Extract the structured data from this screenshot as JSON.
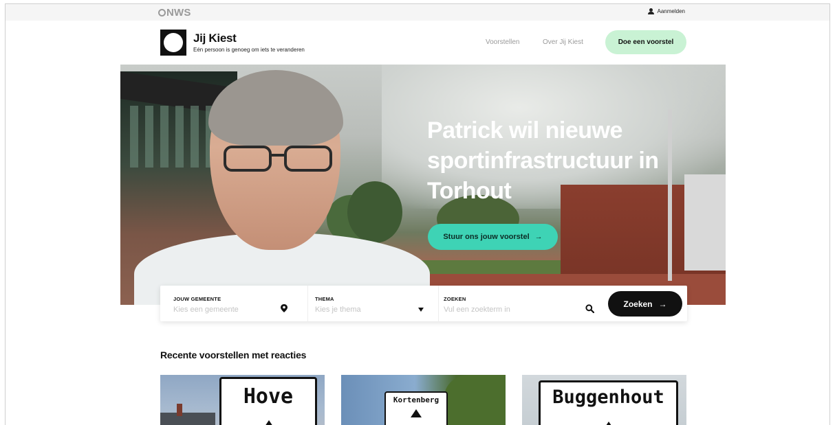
{
  "topbar": {
    "logo_text": "NWS",
    "login_label": "Aanmelden",
    "icons": {
      "user": "user-icon"
    }
  },
  "header": {
    "brand_title": "Jij Kiest",
    "brand_subtitle": "Eén persoon is genoeg om iets te veranderen",
    "nav": [
      "Voorstellen",
      "Over Jij Kiest"
    ],
    "cta_label": "Doe een voorstel",
    "cta_color": "#c9f2d4"
  },
  "hero": {
    "title": "Patrick wil nieuwe sportinfrastructuur in Torhout",
    "cta_label": "Stuur ons jouw voorstel",
    "cta_arrow": "→",
    "cta_color": "#3ed3b5"
  },
  "search": {
    "gemeente": {
      "label": "JOUW GEMEENTE",
      "placeholder": "Kies een gemeente",
      "icon": "location-pin-icon"
    },
    "thema": {
      "label": "THEMA",
      "placeholder": "Kies je thema",
      "icon": "chevron-down-icon"
    },
    "zoeken": {
      "label": "ZOEKEN",
      "placeholder": "Vul een zoekterm in",
      "icon": "search-icon"
    },
    "button_label": "Zoeken",
    "button_arrow": "→"
  },
  "recent": {
    "title": "Recente voorstellen met reacties",
    "cards": [
      {
        "sign_text": "Hove"
      },
      {
        "sign_text": "Kortenberg"
      },
      {
        "sign_text": "Buggenhout"
      }
    ]
  }
}
